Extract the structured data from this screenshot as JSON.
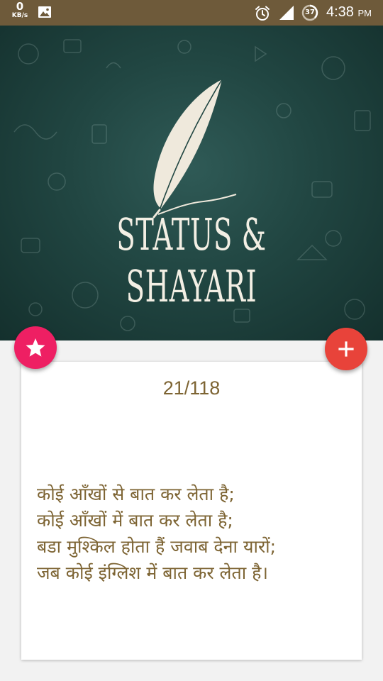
{
  "status_bar": {
    "net_speed": "0",
    "net_unit": "KB/s",
    "battery": "37",
    "time": "4:38",
    "ampm": "PM"
  },
  "banner": {
    "logo_text": "STATUS & SHAYARI",
    "bg_color": "#214642"
  },
  "card": {
    "counter": "21/118",
    "lines": [
      "कोई आँखों से बात कर लेता है;",
      "कोई आँखों में बात कर लेता है;",
      "बडा मुश्किल होता हैं जवाब देना यारों;",
      "जब कोई इंग्लिश में बात कर लेता है।"
    ],
    "text_color": "#7d6433"
  },
  "fabs": {
    "favorite": {
      "icon": "star-icon",
      "color": "#ee1f63"
    },
    "add": {
      "icon": "plus-icon",
      "color": "#e8433a"
    }
  }
}
